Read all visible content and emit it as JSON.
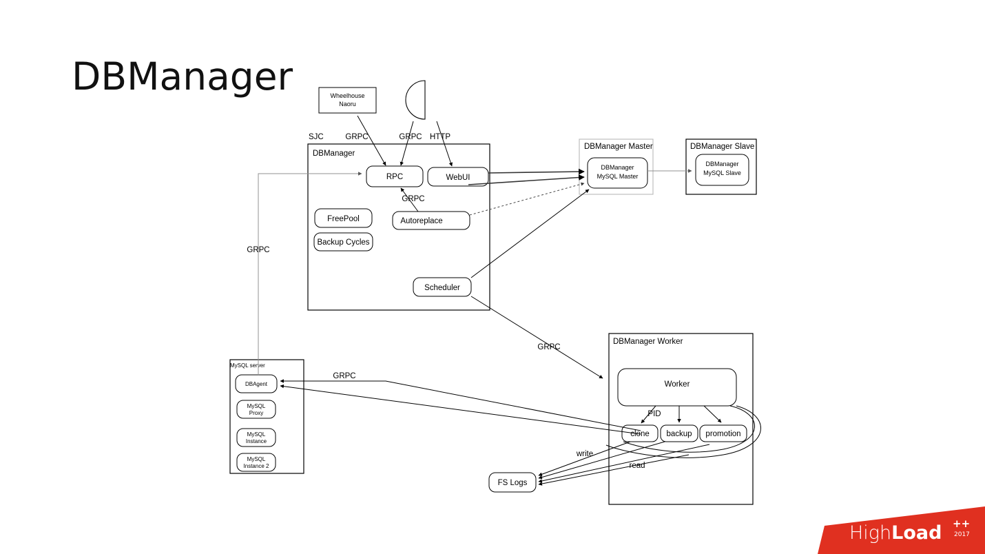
{
  "slide": {
    "title": "DBManager",
    "background": "#ffffff"
  },
  "logo": {
    "name_light": "High",
    "name_bold": "Load",
    "superscript": "++",
    "year": "2017",
    "color": "#e03020"
  },
  "diagram": {
    "type": "architecture-block-diagram",
    "external_nodes": [
      {
        "id": "wheelhouse",
        "label_line1": "Wheelhouse",
        "label_line2": "Naoru",
        "shape": "rect"
      },
      {
        "id": "user",
        "label": "user-actor",
        "shape": "pacman-circle"
      }
    ],
    "containers": [
      {
        "id": "dbmanager",
        "title": "DBManager",
        "outside_label": "SJC",
        "border_color": "#000000",
        "children": [
          {
            "id": "rpc",
            "label": "RPC"
          },
          {
            "id": "webui",
            "label": "WebUI"
          },
          {
            "id": "freepool",
            "label": "FreePool"
          },
          {
            "id": "backup-cycles",
            "label": "Backup Cycles"
          },
          {
            "id": "autoreplace",
            "label": "Autoreplace"
          },
          {
            "id": "scheduler",
            "label": "Scheduler"
          }
        ]
      },
      {
        "id": "dbmanager-master",
        "title": "DBManager Master",
        "border_color": "#b8b8b8",
        "children": [
          {
            "id": "mysql-master",
            "label_line1": "DBManager",
            "label_line2": "MySQL Master"
          }
        ]
      },
      {
        "id": "dbmanager-slave",
        "title": "DBManager Slave",
        "border_color": "#000000",
        "children": [
          {
            "id": "mysql-slave",
            "label_line1": "DBManager",
            "label_line2": "MySQL Slave"
          }
        ]
      },
      {
        "id": "mysql-server",
        "title": "MySQL server",
        "border_color": "#000000",
        "children": [
          {
            "id": "dbagent",
            "label": "DBAgent"
          },
          {
            "id": "mysql-proxy",
            "label_line1": "MySQL",
            "label_line2": "Proxy"
          },
          {
            "id": "mysql-instance",
            "label_line1": "MySQL",
            "label_line2": "Instance"
          },
          {
            "id": "mysql-instance-2",
            "label_line1": "MySQL",
            "label_line2": "Instance 2"
          }
        ]
      },
      {
        "id": "dbmanager-worker",
        "title": "DBManager Worker",
        "border_color": "#000000",
        "children": [
          {
            "id": "worker",
            "label": "Worker"
          },
          {
            "id": "clone",
            "label": "clone"
          },
          {
            "id": "backup",
            "label": "backup"
          },
          {
            "id": "promotion",
            "label": "promotion"
          }
        ]
      }
    ],
    "standalone_nodes": [
      {
        "id": "fs-logs",
        "label": "FS Logs"
      }
    ],
    "edge_labels": [
      {
        "id": "grpc-wheelhouse",
        "text": "GRPC"
      },
      {
        "id": "grpc-user",
        "text": "GRPC"
      },
      {
        "id": "http-user",
        "text": "HTTP"
      },
      {
        "id": "grpc-autoreplace",
        "text": "GRPC"
      },
      {
        "id": "grpc-left-trunk",
        "text": "GRPC"
      },
      {
        "id": "grpc-scheduler-worker",
        "text": "GRPC"
      },
      {
        "id": "grpc-worker-dbagent",
        "text": "GRPC"
      },
      {
        "id": "pid",
        "text": "PID"
      },
      {
        "id": "write",
        "text": "write"
      },
      {
        "id": "read",
        "text": "read"
      }
    ]
  }
}
